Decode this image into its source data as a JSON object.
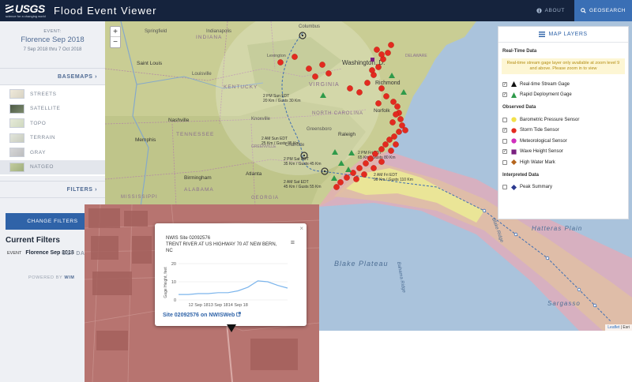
{
  "header": {
    "logo_text": "USGS",
    "logo_tagline": "science for a changing world",
    "app_title": "Flood Event Viewer",
    "about_label": "ABOUT",
    "geosearch_label": "GEOSEARCH"
  },
  "sidebar": {
    "event_label": "EVENT:",
    "event_name": "Florence Sep 2018",
    "event_dates": "7 Sep 2018 thru 7 Oct 2018",
    "basemaps_label": "BASEMAPS",
    "basemaps": [
      {
        "label": "STREETS",
        "color": "#e6e2d6"
      },
      {
        "label": "SATELLITE",
        "color": "#5d6b53"
      },
      {
        "label": "TOPO",
        "color": "#dfe3d3"
      },
      {
        "label": "TERRAIN",
        "color": "#d9ddd0"
      },
      {
        "label": "GRAY",
        "color": "#c9cacc"
      },
      {
        "label": "NATGEO",
        "color": "#b8c39a"
      }
    ],
    "active_basemap": "NATGEO",
    "filters_label": "FILTERS",
    "change_filters_label": "CHANGE FILTERS",
    "current_filters_label": "Current Filters",
    "filter_key": "EVENT",
    "filter_value": "Florence Sep 2018",
    "get_data_label": "GET DA",
    "powered_by": "POWERED BY",
    "powered_by_name": "WIM"
  },
  "map": {
    "zoom_in": "+",
    "zoom_out": "−",
    "attribution_link": "Leaflet",
    "attribution_rest": "| Esri",
    "labels": {
      "indiana": "INDIANA",
      "indianapolis": "Indianapolis",
      "springfield": "Springfield",
      "columbus": "Columbus",
      "saint_louis": "Saint Louis",
      "louisville": "Louisville",
      "kentucky": "KENTUCKY",
      "virginia": "VIRGINIA",
      "washington": "Washington, D.",
      "richmond": "Richmond",
      "norfolk": "Norfolk",
      "nashville": "Nashville",
      "tennessee": "TENNESSEE",
      "knoxville": "Knoxville",
      "greensboro": "Greensboro",
      "raleigh": "Raleigh",
      "north_carolina": "NORTH CAROLINA",
      "charlotte": "Charlotte",
      "greenville": "GREENVILLE",
      "memphis": "Memphis",
      "birmingham": "Birmingham",
      "atlanta": "Atlanta",
      "alabama": "ALABAMA",
      "georgia": "GEORGIA",
      "mississippi": "MISSISSIPPI",
      "delaware": "DELAWARE",
      "blake_plateau": "Blake Plateau",
      "bahama_ridge": "Bahama Ridge",
      "blake_ridge": "Blake Ridge",
      "hatteras_plain": "Hatteras Plain",
      "sargasso": "Sargasso",
      "kentucky_small": "Lexington"
    },
    "storm_points": [
      {
        "line1": "2 AM Sun EDT",
        "line2": "25 Km / Gusts 35 Km"
      },
      {
        "line1": "2 PM Sat EDT",
        "line2": "35 Km / Gusts 45 Km"
      },
      {
        "line1": "2 AM Sat EDT",
        "line2": "45 Km / Gusts 55 Km"
      },
      {
        "line1": "2 PM Fri EDT",
        "line2": "65 Km / Gusts 80 Km"
      },
      {
        "line1": "2 AM Fri EDT",
        "line2": "90 Km / Gusts 110 Km"
      },
      {
        "line1": "2 PM Sun EDT",
        "line2": "20 Km / Gusts 30 Km"
      }
    ]
  },
  "layers": {
    "title": "MAP LAYERS",
    "realtime_heading": "Real-Time Data",
    "realtime_note": "Real-time stream gage layer only available at zoom level 9 and above. Please zoom in to view",
    "realtime_items": [
      {
        "label": "Real-time Stream Gage",
        "checked": true,
        "symbol": "triangle",
        "color": "#111111"
      },
      {
        "label": "Rapid Deployment Gage",
        "checked": true,
        "symbol": "triangle",
        "color": "#2f9a4a"
      }
    ],
    "observed_heading": "Observed Data",
    "observed_items": [
      {
        "label": "Barometric Pressure Sensor",
        "checked": false,
        "symbol": "circle",
        "color": "#f1e04a"
      },
      {
        "label": "Storm Tide Sensor",
        "checked": true,
        "symbol": "circle",
        "color": "#e32a1f"
      },
      {
        "label": "Meteorological Sensor",
        "checked": false,
        "symbol": "circle",
        "color": "#d02fbd"
      },
      {
        "label": "Wave Height Sensor",
        "checked": true,
        "symbol": "square",
        "color": "#7a2080"
      },
      {
        "label": "High Water Mark",
        "checked": false,
        "symbol": "diamond",
        "color": "#b5651d"
      }
    ],
    "interpreted_heading": "Interpreted Data",
    "interpreted_items": [
      {
        "label": "Peak Summary",
        "checked": false,
        "symbol": "diamond",
        "color": "#2c3a8f"
      }
    ]
  },
  "popup": {
    "title_line1": "NWIS Site 02092576",
    "title_line2": "TRENT RIVER AT US HIGHWAY 70 AT NEW BERN, NC",
    "link_text": "Site 02092576 on NWISWeb",
    "close": "×",
    "menu": "≡"
  },
  "chart_data": {
    "type": "line",
    "title": "",
    "xlabel": "",
    "ylabel": "Gage Height, feet",
    "x": [
      "11 Sep 18",
      "11.5 Sep 18",
      "12 Sep 18",
      "12.5 Sep 18",
      "13 Sep 18",
      "13.5 Sep 18",
      "14 Sep 18",
      "14.25 Sep 18",
      "14.5 Sep 18",
      "14.75 Sep 18",
      "15 Sep 18",
      "15.25 Sep 18"
    ],
    "x_ticks": [
      "12 Sep 18",
      "13 Sep 18",
      "14 Sep 18"
    ],
    "series": [
      {
        "values": [
          3,
          3,
          3.5,
          3.5,
          4,
          4,
          5,
          7,
          10.5,
          10,
          8,
          6.5
        ]
      }
    ],
    "y_ticks": [
      0,
      10,
      20
    ],
    "ylim": [
      0,
      20
    ],
    "grid": true,
    "legend": "none",
    "color": "#7cb5ec"
  }
}
